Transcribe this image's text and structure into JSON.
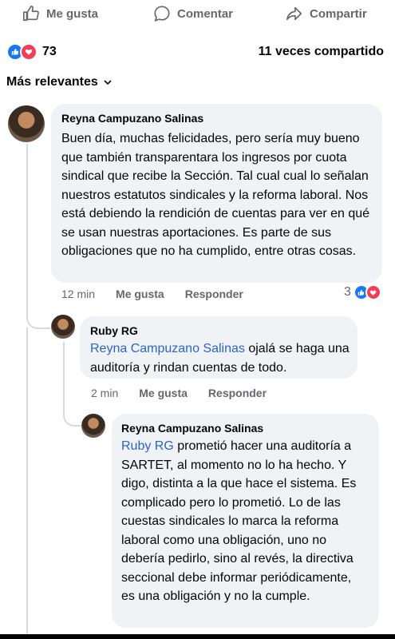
{
  "post_actions": {
    "like": "Me gusta",
    "comment": "Comentar",
    "share": "Compartir"
  },
  "stats": {
    "reactions_count": "73",
    "shares": "11 veces compartido"
  },
  "sort_label": "Más relevantes",
  "comments": [
    {
      "author": "Reyna Campuzano Salinas",
      "text": "Buen día, muchas felicidades, pero sería muy bueno que también transparentara los ingresos por cuota sindical que recibe la Sección. Tal cual cual lo señalan nuestros estatutos sindicales y la reforma laboral. Nos está debiendo la rendición de cuentas para ver en qué se usan nuestras aportaciones. Es parte de sus obligaciones que no ha cumplido, entre otras cosas.",
      "time": "12 min",
      "like": "Me gusta",
      "reply": "Responder",
      "reaction_count": "3"
    },
    {
      "author": "Ruby RG",
      "mention": "Reyna Campuzano Salinas",
      "text": " ojalá se haga una auditoría y rindan cuentas de todo.",
      "time": "2 min",
      "like": "Me gusta",
      "reply": "Responder"
    },
    {
      "author": "Reyna Campuzano Salinas",
      "mention": "Ruby RG",
      "text": " prometió  hacer una auditoría a SARTET, al momento no lo ha hecho. Y digo, distinta a la que hace el sistema. Es complicado pero lo prometió. Lo de las cuestas sindicales lo marca la reforma laboral como una obligación, uno no debería pedirlo, sino al revés, la directiva seccional debe informar periódicamente, es una obligación y no la cumple."
    }
  ],
  "colors": {
    "like_blue": "#1877f2",
    "love_red": "#f33e58",
    "mention_blue": "#2a66c7",
    "bubble_gray": "#f0f2f5"
  },
  "icons": [
    "thumbs-up-icon",
    "comment-icon",
    "share-icon",
    "chevron-down-icon"
  ]
}
